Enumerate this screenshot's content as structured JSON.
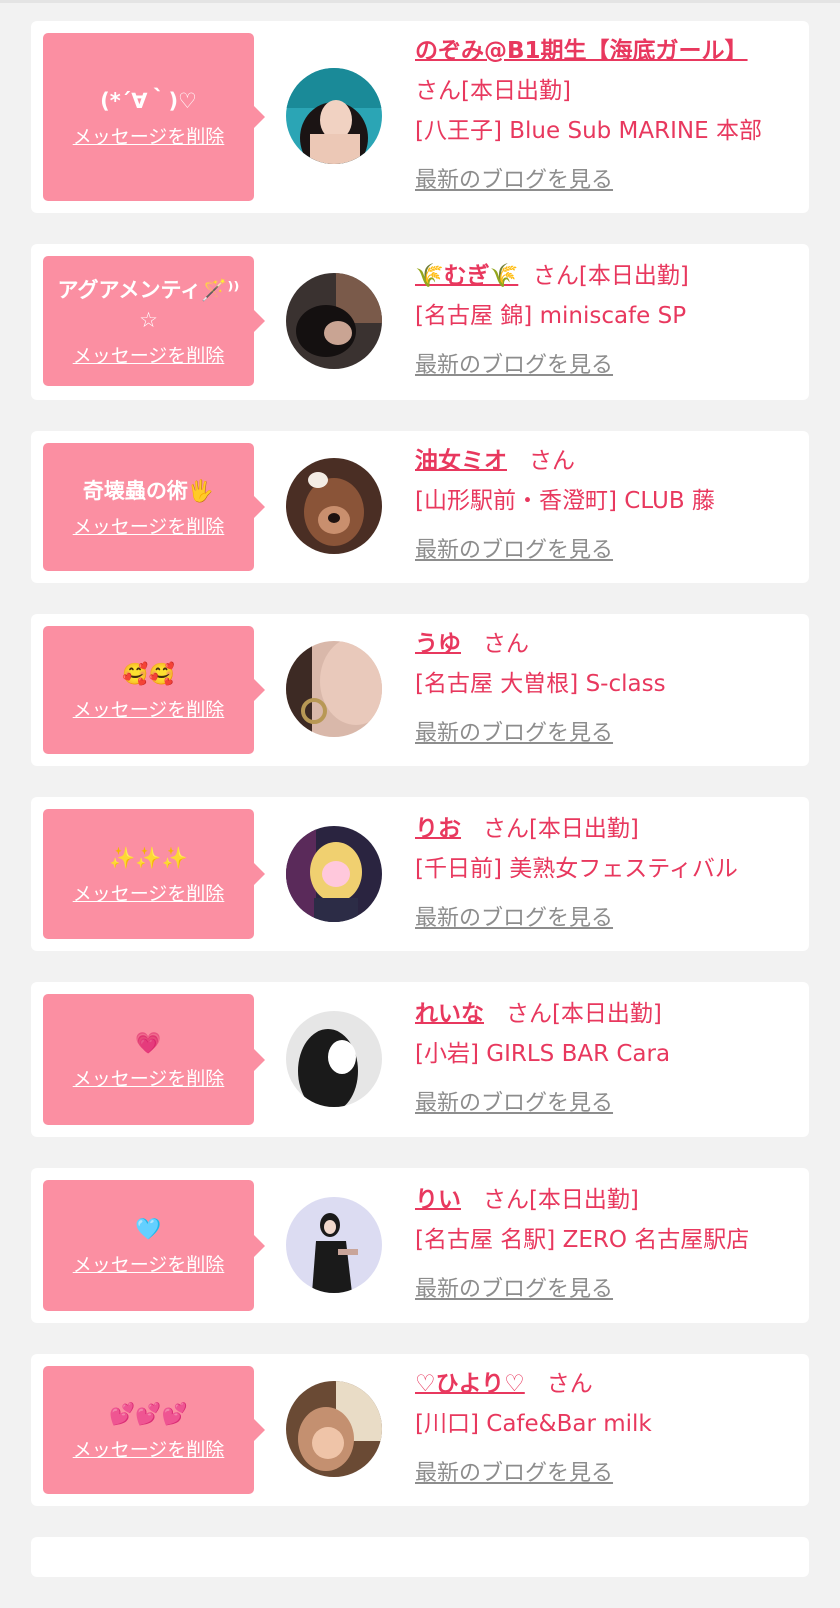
{
  "colors": {
    "background": "#f2f2f2",
    "card": "#ffffff",
    "bubble": "#fb8fa2",
    "accent": "#e8385e",
    "muted": "#8d8d8d"
  },
  "delete_label": "メッセージを削除",
  "blog_label": "最新のブログを見る",
  "cards": [
    {
      "message": "(*´∀｀)♡",
      "name": "のぞみ@B1期生【海底ガール】",
      "san": "さん[本日出勤]",
      "shop": "[八王子] Blue Sub MARINE 本部",
      "avatar_icon": "avatar-photo"
    },
    {
      "message": "アグアメンティ🪄⁾⁾☆",
      "name": "🌾むぎ🌾",
      "san": "さん[本日出勤]",
      "shop": "[名古屋 錦] miniscafe SP",
      "avatar_icon": "avatar-photo"
    },
    {
      "message": "奇壊蟲の術🖐",
      "name": "油女ミオ",
      "san": "さん",
      "shop": "[山形駅前・香澄町] CLUB 藤",
      "avatar_icon": "avatar-photo"
    },
    {
      "message": "🥰🥰",
      "name": "うゆ",
      "san": "さん",
      "shop": "[名古屋 大曽根] S-class",
      "avatar_icon": "avatar-photo"
    },
    {
      "message": "✨✨✨",
      "name": "りお",
      "san": "さん[本日出勤]",
      "shop": "[千日前] 美熟女フェスティバル",
      "avatar_icon": "avatar-photo"
    },
    {
      "message": "💗",
      "name": "れいな",
      "san": "さん[本日出勤]",
      "shop": "[小岩] GIRLS BAR Cara",
      "avatar_icon": "avatar-photo"
    },
    {
      "message": "🩵",
      "name": "りい",
      "san": "さん[本日出勤]",
      "shop": "[名古屋 名駅] ZERO 名古屋駅店",
      "avatar_icon": "avatar-photo"
    },
    {
      "message": "💕💕💕",
      "name": "♡ひより♡",
      "san": "さん",
      "shop": "[川口] Cafe&Bar milk",
      "avatar_icon": "avatar-photo"
    }
  ]
}
